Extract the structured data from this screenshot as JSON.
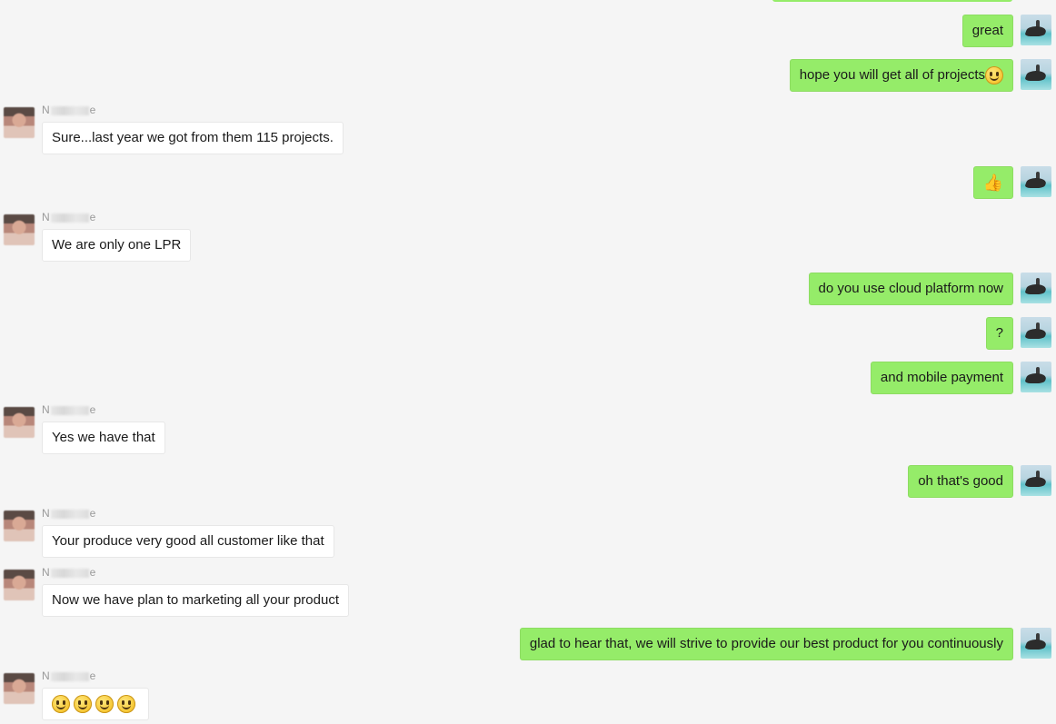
{
  "theme": {
    "background": "#f5f5f5",
    "outgoing_bubble": "#95ec69",
    "incoming_bubble": "#ffffff"
  },
  "contact": {
    "name_prefix": "N",
    "name_suffix": "e"
  },
  "messages": [
    {
      "id": "m1",
      "side": "right",
      "text": "great"
    },
    {
      "id": "m2",
      "side": "right",
      "text": "hope you will get all of projects",
      "emoji": "smile-icon"
    },
    {
      "id": "m3",
      "side": "left",
      "text": "Sure...last year we got from them 115 projects."
    },
    {
      "id": "m4",
      "side": "right",
      "text": "",
      "emoji": "thumbs-up-icon",
      "glyph": "👍"
    },
    {
      "id": "m5",
      "side": "left",
      "text": "We are only one LPR"
    },
    {
      "id": "m6",
      "side": "right",
      "text": "do you use cloud platform now"
    },
    {
      "id": "m7",
      "side": "right",
      "text": "?"
    },
    {
      "id": "m8",
      "side": "right",
      "text": "and mobile payment"
    },
    {
      "id": "m9",
      "side": "left",
      "text": "Yes we have that"
    },
    {
      "id": "m10",
      "side": "right",
      "text": "oh that's good"
    },
    {
      "id": "m11",
      "side": "left",
      "text": "Your produce very good all customer like that"
    },
    {
      "id": "m12",
      "side": "left",
      "text": "Now we have plan to marketing all your product"
    },
    {
      "id": "m13",
      "side": "right",
      "text": "glad to hear that, we will strive to provide our best product for you continuously"
    },
    {
      "id": "m14",
      "side": "left",
      "text": "",
      "emoji": "smile-icon",
      "emoji_count": 4
    }
  ]
}
